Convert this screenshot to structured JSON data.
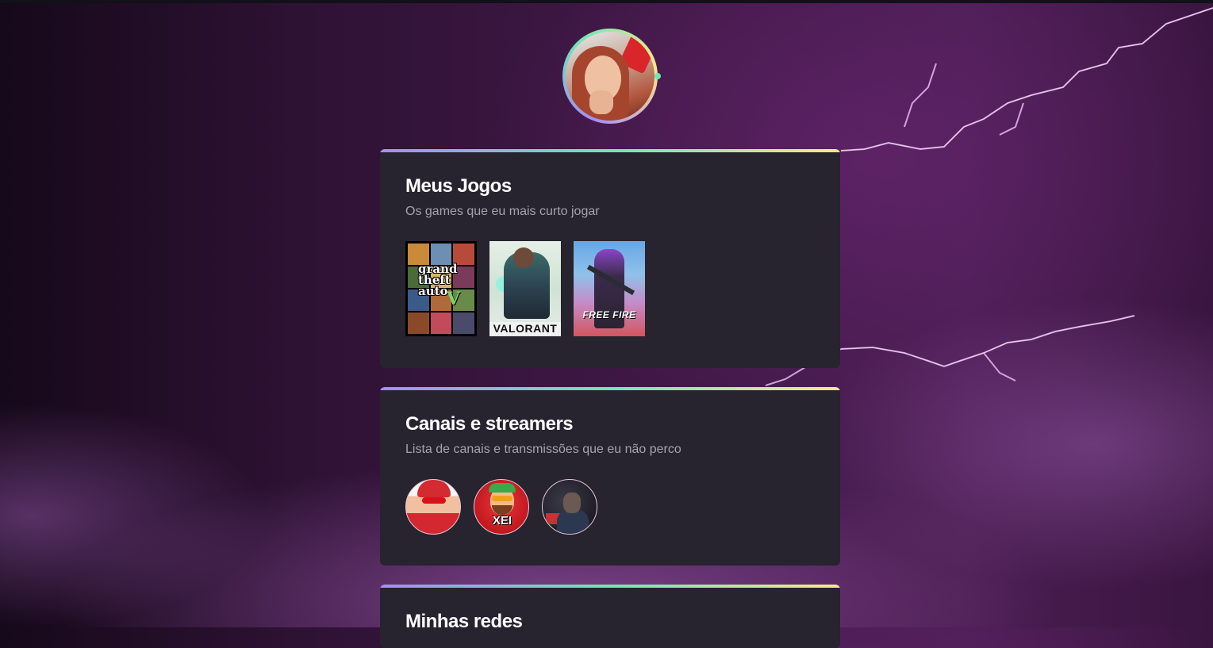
{
  "profile": {
    "avatar_alt": "profile-photo"
  },
  "games_section": {
    "title": "Meus Jogos",
    "subtitle": "Os games que eu mais curto jogar",
    "games": [
      {
        "name": "GTA V",
        "logo_text": "grand theft auto",
        "logo_numeral": "V"
      },
      {
        "name": "Valorant",
        "logo_text": "VALORANT"
      },
      {
        "name": "Free Fire",
        "logo_text": "FREE FIRE"
      }
    ]
  },
  "channels_section": {
    "title": "Canais e streamers",
    "subtitle": "Lista de canais e transmissões que eu não perco",
    "channels": [
      {
        "name": "channel-1"
      },
      {
        "name": "channel-2",
        "logo_text": "XEI"
      },
      {
        "name": "channel-3"
      }
    ]
  },
  "social_section": {
    "title": "Minhas redes"
  },
  "colors": {
    "card_bg": "#27232f",
    "gradient_start": "#a78bfa",
    "gradient_mid": "#6ee7b7",
    "gradient_end": "#fde68a",
    "title": "#ffffff",
    "subtitle": "#a6a1b0"
  }
}
